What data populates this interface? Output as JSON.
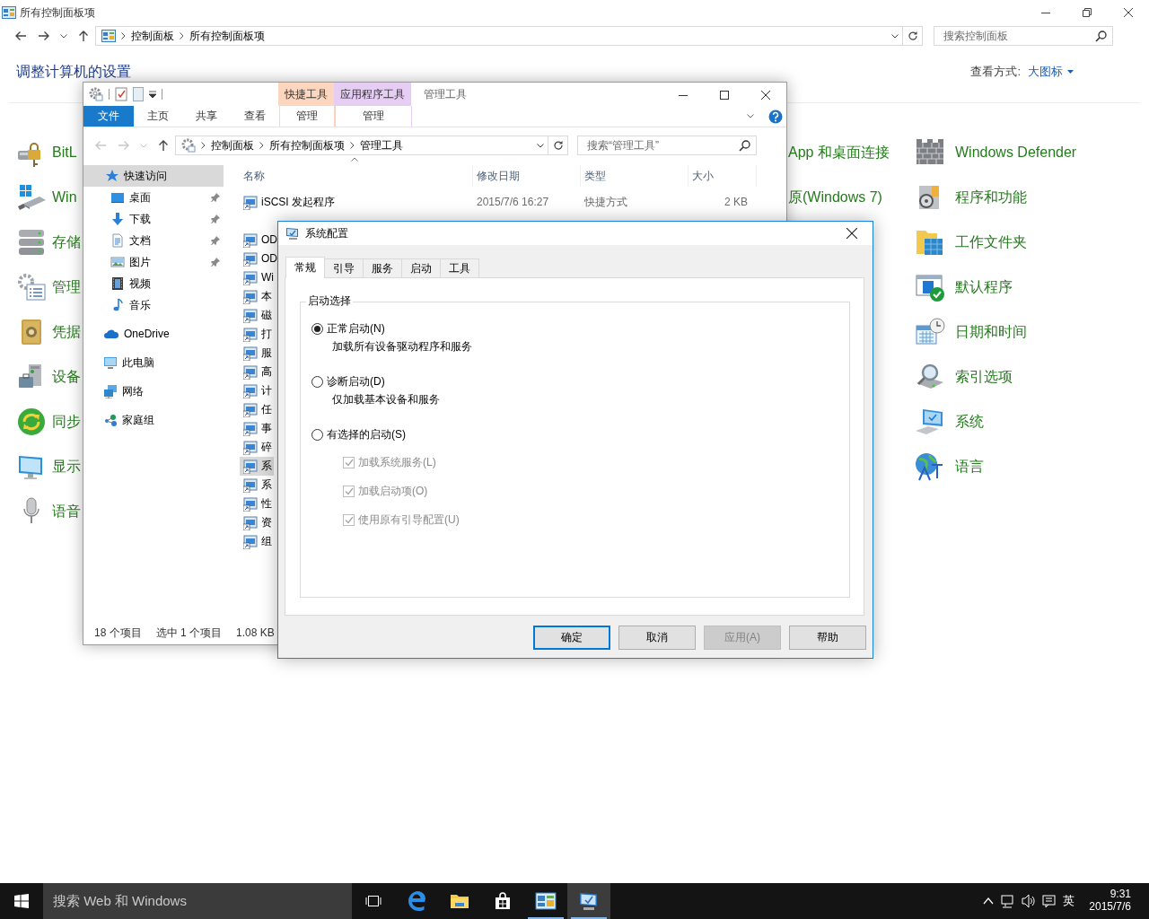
{
  "control_panel": {
    "title": "所有控制面板项",
    "breadcrumb": [
      "控制面板",
      "所有控制面板项"
    ],
    "search": {
      "placeholder": "搜索控制面板"
    },
    "heading": "调整计算机的设置",
    "view_label": "查看方式:",
    "view_value": "大图标",
    "columns": [
      {
        "items": [
          "BitL",
          "Win",
          "存储",
          "管理",
          "凭据",
          "设备",
          "同步",
          "显示",
          "语音"
        ]
      },
      {
        "items": [
          "App 和桌面连接",
          "原(Windows 7)"
        ]
      },
      {
        "items": [
          "Windows Defender",
          "程序和功能",
          "工作文件夹",
          "默认程序",
          "日期和时间",
          "索引选项",
          "系统",
          "语言"
        ]
      }
    ]
  },
  "explorer": {
    "contextual_groups": [
      {
        "label": "快捷工具",
        "color": "#fcd6be"
      },
      {
        "label": "应用程序工具",
        "color": "#e6cdf3"
      }
    ],
    "title": "管理工具",
    "ribbon_tabs": [
      {
        "label": "文件",
        "kind": "file"
      },
      {
        "label": "主页",
        "kind": "plain"
      },
      {
        "label": "共享",
        "kind": "plain"
      },
      {
        "label": "查看",
        "kind": "plain"
      },
      {
        "label": "管理",
        "kind": "context"
      },
      {
        "label": "管理",
        "kind": "context"
      }
    ],
    "breadcrumb": [
      "控制面板",
      "所有控制面板项",
      "管理工具"
    ],
    "search": {
      "placeholder": "搜索“管理工具”"
    },
    "nav": [
      {
        "label": "快速访问",
        "selected": true,
        "children": [
          {
            "label": "桌面",
            "pinned": true,
            "selected": false
          },
          {
            "label": "下载",
            "pinned": true,
            "selected": false
          },
          {
            "label": "文档",
            "pinned": true,
            "selected": false
          },
          {
            "label": "图片",
            "pinned": true,
            "selected": false
          },
          {
            "label": "视频",
            "pinned": false,
            "selected": false
          },
          {
            "label": "音乐",
            "pinned": false,
            "selected": false
          }
        ]
      },
      {
        "label": "OneDrive",
        "selected": false
      },
      {
        "label": "此电脑",
        "selected": false
      },
      {
        "label": "网络",
        "selected": false
      },
      {
        "label": "家庭组",
        "selected": false
      }
    ],
    "columns": [
      "名称",
      "修改日期",
      "类型",
      "大小"
    ],
    "files": [
      {
        "name": "iSCSI 发起程序",
        "date": "2015/7/6 16:27",
        "type": "快捷方式",
        "size": "2 KB",
        "selected": false
      },
      {
        "name": "OD",
        "selected": false
      },
      {
        "name": "OD",
        "selected": false
      },
      {
        "name": "Wi",
        "selected": false
      },
      {
        "name": "本",
        "selected": false
      },
      {
        "name": "磁",
        "selected": false
      },
      {
        "name": "打",
        "selected": false
      },
      {
        "name": "服",
        "selected": false
      },
      {
        "name": "高",
        "selected": false
      },
      {
        "name": "计",
        "selected": false
      },
      {
        "name": "任",
        "selected": false
      },
      {
        "name": "事",
        "selected": false
      },
      {
        "name": "碎",
        "selected": false
      },
      {
        "name": "系",
        "selected": true
      },
      {
        "name": "系",
        "selected": false
      },
      {
        "name": "性",
        "selected": false
      },
      {
        "name": "资",
        "selected": false
      },
      {
        "name": "组",
        "selected": false
      }
    ],
    "status": [
      "18 个项目",
      "选中 1 个项目",
      "1.08 KB"
    ]
  },
  "dialog": {
    "title": "系统配置",
    "tabs": [
      {
        "label": "常规",
        "selected": true
      },
      {
        "label": "引导",
        "selected": false
      },
      {
        "label": "服务",
        "selected": false
      },
      {
        "label": "启动",
        "selected": false
      },
      {
        "label": "工具",
        "selected": false
      }
    ],
    "group_label": "启动选择",
    "options": [
      {
        "label": "正常启动(N)",
        "description": "加载所有设备驱动程序和服务",
        "selected": true
      },
      {
        "label": "诊断启动(D)",
        "description": "仅加载基本设备和服务",
        "selected": false
      },
      {
        "label": "有选择的启动(S)",
        "selected": false,
        "children": [
          {
            "label": "加载系统服务(L)",
            "checked": true,
            "disabled": true
          },
          {
            "label": "加载启动项(O)",
            "checked": true,
            "disabled": true
          },
          {
            "label": "使用原有引导配置(U)",
            "checked": true,
            "disabled": true
          }
        ]
      }
    ],
    "buttons": [
      {
        "label": "确定",
        "default": true,
        "disabled": false
      },
      {
        "label": "取消",
        "default": false,
        "disabled": false
      },
      {
        "label": "应用(A)",
        "default": false,
        "disabled": true
      },
      {
        "label": "帮助",
        "default": false,
        "disabled": false
      }
    ]
  },
  "taskbar": {
    "search": {
      "placeholder": "搜索 Web 和 Windows"
    },
    "apps": [
      {
        "running": false,
        "selected": false
      },
      {
        "running": false,
        "selected": false
      },
      {
        "running": false,
        "selected": false
      },
      {
        "running": false,
        "selected": false
      },
      {
        "running": true,
        "selected": false
      },
      {
        "running": true,
        "selected": true
      }
    ],
    "tray": {
      "input_language": "英",
      "time": "9:31",
      "date": "2015/7/6"
    }
  }
}
